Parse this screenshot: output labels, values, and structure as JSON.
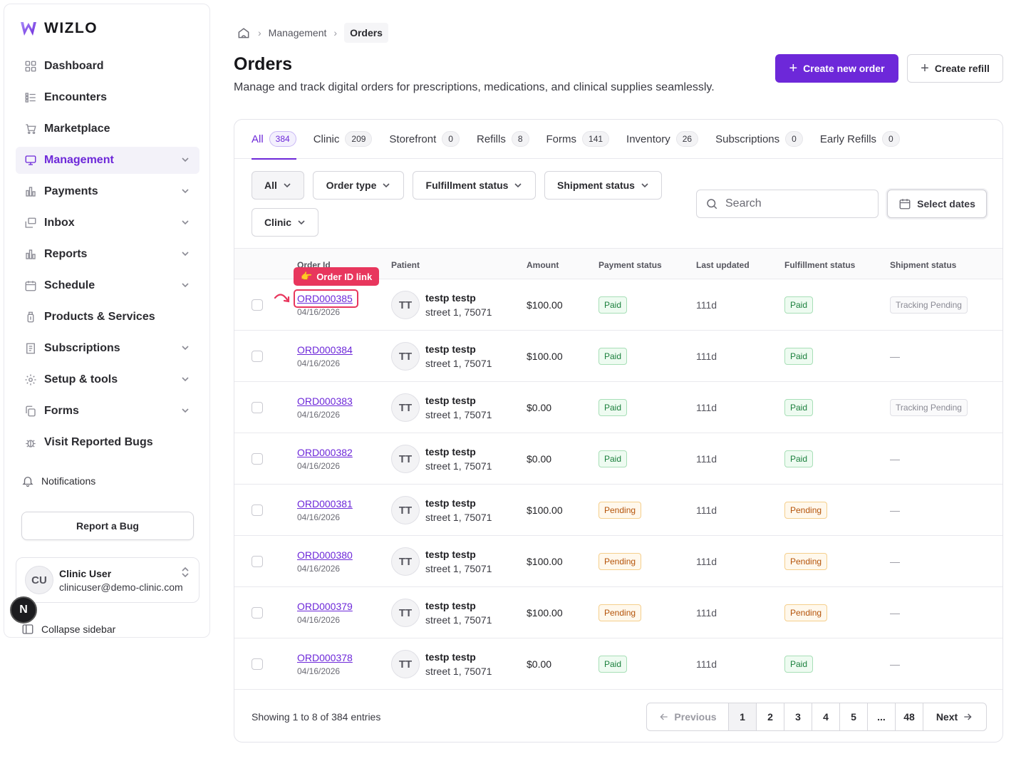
{
  "brand": {
    "name": "WIZLO"
  },
  "sidebar": {
    "items": [
      {
        "label": "Dashboard",
        "icon": "dashboard-icon",
        "chevron": false
      },
      {
        "label": "Encounters",
        "icon": "list-icon",
        "chevron": false
      },
      {
        "label": "Marketplace",
        "icon": "cart-icon",
        "chevron": false
      },
      {
        "label": "Management",
        "icon": "monitor-icon",
        "chevron": true,
        "active": true
      },
      {
        "label": "Payments",
        "icon": "bar-chart-icon",
        "chevron": true
      },
      {
        "label": "Inbox",
        "icon": "inbox-icon",
        "chevron": true
      },
      {
        "label": "Reports",
        "icon": "bar-chart-icon",
        "chevron": true
      },
      {
        "label": "Schedule",
        "icon": "calendar-icon",
        "chevron": true
      },
      {
        "label": "Products & Services",
        "icon": "bottle-icon",
        "chevron": false
      },
      {
        "label": "Subscriptions",
        "icon": "receipt-icon",
        "chevron": true
      },
      {
        "label": "Setup & tools",
        "icon": "gear-icon",
        "chevron": true
      },
      {
        "label": "Forms",
        "icon": "copy-icon",
        "chevron": true
      },
      {
        "label": "Visit Reported Bugs",
        "icon": "bug-icon",
        "chevron": false
      }
    ],
    "notifications_label": "Notifications",
    "report_bug_label": "Report a Bug",
    "user": {
      "initials": "CU",
      "name": "Clinic User",
      "email": "clinicuser@demo-clinic.com"
    },
    "n_badge": "N",
    "collapse_label": "Collapse sidebar"
  },
  "breadcrumb": {
    "items": [
      "Management",
      "Orders"
    ]
  },
  "page": {
    "title": "Orders",
    "subtitle": "Manage and track digital orders for prescriptions, medications, and clinical supplies seamlessly.",
    "create_order_label": "Create new order",
    "create_refill_label": "Create refill"
  },
  "tabs": [
    {
      "label": "All",
      "count": "384",
      "active": true
    },
    {
      "label": "Clinic",
      "count": "209"
    },
    {
      "label": "Storefront",
      "count": "0"
    },
    {
      "label": "Refills",
      "count": "8"
    },
    {
      "label": "Forms",
      "count": "141"
    },
    {
      "label": "Inventory",
      "count": "26"
    },
    {
      "label": "Subscriptions",
      "count": "0"
    },
    {
      "label": "Early Refills",
      "count": "0"
    }
  ],
  "filters": {
    "all_label": "All",
    "order_type_label": "Order type",
    "fulfillment_label": "Fulfillment status",
    "shipment_label": "Shipment status",
    "clinic_label": "Clinic",
    "search_placeholder": "Search",
    "select_dates_label": "Select dates"
  },
  "table": {
    "headers": {
      "order_id": "Order Id",
      "patient": "Patient",
      "amount": "Amount",
      "payment_status": "Payment status",
      "last_updated": "Last updated",
      "fulfillment_status": "Fulfillment status",
      "shipment_status": "Shipment status"
    },
    "rows": [
      {
        "id": "ORD000385",
        "date": "04/16/2026",
        "initials": "TT",
        "name": "testp testp",
        "address": "street 1, 75071",
        "amount": "$100.00",
        "payment": "Paid",
        "updated": "111d",
        "fulfillment": "Paid",
        "shipment": "Tracking Pending"
      },
      {
        "id": "ORD000384",
        "date": "04/16/2026",
        "initials": "TT",
        "name": "testp testp",
        "address": "street 1, 75071",
        "amount": "$100.00",
        "payment": "Paid",
        "updated": "111d",
        "fulfillment": "Paid",
        "shipment": "—"
      },
      {
        "id": "ORD000383",
        "date": "04/16/2026",
        "initials": "TT",
        "name": "testp testp",
        "address": "street 1, 75071",
        "amount": "$0.00",
        "payment": "Paid",
        "updated": "111d",
        "fulfillment": "Paid",
        "shipment": "Tracking Pending"
      },
      {
        "id": "ORD000382",
        "date": "04/16/2026",
        "initials": "TT",
        "name": "testp testp",
        "address": "street 1, 75071",
        "amount": "$0.00",
        "payment": "Paid",
        "updated": "111d",
        "fulfillment": "Paid",
        "shipment": "—"
      },
      {
        "id": "ORD000381",
        "date": "04/16/2026",
        "initials": "TT",
        "name": "testp testp",
        "address": "street 1, 75071",
        "amount": "$100.00",
        "payment": "Pending",
        "updated": "111d",
        "fulfillment": "Pending",
        "shipment": "—"
      },
      {
        "id": "ORD000380",
        "date": "04/16/2026",
        "initials": "TT",
        "name": "testp testp",
        "address": "street 1, 75071",
        "amount": "$100.00",
        "payment": "Pending",
        "updated": "111d",
        "fulfillment": "Pending",
        "shipment": "—"
      },
      {
        "id": "ORD000379",
        "date": "04/16/2026",
        "initials": "TT",
        "name": "testp testp",
        "address": "street 1, 75071",
        "amount": "$100.00",
        "payment": "Pending",
        "updated": "111d",
        "fulfillment": "Pending",
        "shipment": "—"
      },
      {
        "id": "ORD000378",
        "date": "04/16/2026",
        "initials": "TT",
        "name": "testp testp",
        "address": "street 1, 75071",
        "amount": "$0.00",
        "payment": "Paid",
        "updated": "111d",
        "fulfillment": "Paid",
        "shipment": "—"
      }
    ]
  },
  "pagination": {
    "showing": "Showing 1 to 8 of 384 entries",
    "previous_label": "Previous",
    "next_label": "Next",
    "pages": [
      "1",
      "2",
      "3",
      "4",
      "5",
      "...",
      "48"
    ],
    "current": "1"
  },
  "annotation": {
    "label": "Order ID link",
    "emoji": "👉",
    "color": "#e8365d"
  },
  "colors": {
    "accent": "#6d28d9",
    "paid": "#1a7f3c",
    "pending": "#b45309",
    "highlight": "#e8365d"
  }
}
